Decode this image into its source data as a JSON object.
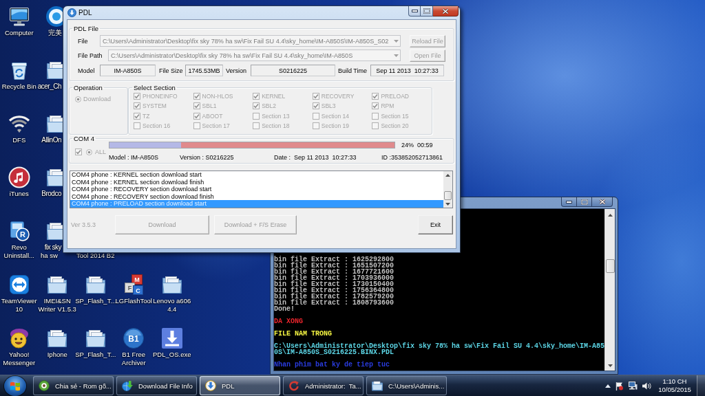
{
  "desktop": {
    "icon_columns": [
      {
        "icons": [
          {
            "kind": "computer",
            "label_lines": [
              "Computer"
            ],
            "cut": false
          },
          {
            "kind": "recycle-bin",
            "label_lines": [
              "Recycle Bin"
            ],
            "cut": false
          },
          {
            "kind": "wifi",
            "label_lines": [
              "DFS"
            ],
            "cut": false
          },
          {
            "kind": "music",
            "label_lines": [
              "iTunes"
            ],
            "cut": false
          },
          {
            "kind": "badge",
            "logo_text": "R",
            "label_lines": [
              "Revo",
              "Uninstall..."
            ],
            "cut": false
          },
          {
            "kind": "remote",
            "label_lines": [
              "TeamViewer",
              "10"
            ],
            "cut": false
          },
          {
            "kind": "smiley",
            "label_lines": [
              "Yahoo!",
              "Messenger"
            ],
            "cut": false
          }
        ]
      },
      {
        "icons": [
          {
            "kind": "ring",
            "label_lines": [
              "完美"
            ],
            "cut": true
          },
          {
            "kind": "folder",
            "label_lines": [
              "acer_Ch"
            ],
            "cut": true
          },
          {
            "kind": "folder",
            "label_lines": [
              "AllinOn"
            ],
            "cut": true
          },
          {
            "kind": "folder",
            "label_lines": [
              "Brodco"
            ],
            "cut": true
          },
          {
            "kind": "folder",
            "label_lines": [
              "fix sky",
              "ha sw"
            ],
            "cut": true
          },
          {
            "kind": "folder",
            "label_lines": [
              "IMEI&SN",
              "Writer V1.5.3"
            ],
            "cut": false
          },
          {
            "kind": "folder",
            "label_lines": [
              "Iphone"
            ],
            "cut": false
          }
        ]
      },
      {
        "icons": [
          {
            "label_lines": [
              "Tool 2014 B2"
            ],
            "cut": false
          },
          {
            "kind": "folder",
            "label_lines": [
              "SP_Flash_T..."
            ],
            "cut": false
          },
          {
            "kind": "folder",
            "label_lines": [
              "SP_Flash_T..."
            ],
            "cut": false
          }
        ]
      },
      {
        "icons": [
          {
            "kind": "cubes",
            "logo_letters": [
              "M",
              "F",
              "C"
            ],
            "label_lines": [
              "LGFlashTool"
            ],
            "cut": false
          },
          {
            "kind": "disc",
            "logo_text": "B1",
            "label_lines": [
              "B1 Free",
              "Archiver"
            ],
            "cut": false
          }
        ]
      },
      {
        "icons": [
          {
            "kind": "folder",
            "label_lines": [
              "Lenovo a606",
              "4.4"
            ],
            "cut": false
          },
          {
            "kind": "download",
            "label_lines": [
              "PDL_OS.exe"
            ],
            "cut": false
          }
        ]
      }
    ]
  },
  "console_window": {
    "blocks": [
      {
        "color": "#c0c0c0",
        "lines": [
          "bin file Extract : 1625292800",
          "bin file Extract : 1651507200",
          "bin file Extract : 1677721600",
          "bin file Extract : 1703936000",
          "bin file Extract : 1730150400",
          "bin file Extract : 1756364800",
          "bin file Extract : 1782579200",
          "bin file Extract : 1808793600",
          "Done!"
        ]
      },
      {
        "color": "#e8242c",
        "lines": [
          "DA XONG"
        ]
      },
      {
        "color": "#f4f442",
        "lines": [
          "FILE NAM TRONG"
        ]
      },
      {
        "color": "#5cd6e6",
        "lines": [
          "C:\\Users\\Administrator\\Desktop\\fix sky 78% ha sw\\Fix Fail SU 4.4\\sky_home\\IM-A85",
          "0S\\IM-A850S_S0216225.BINX.PDL"
        ]
      },
      {
        "color": "#2a3ce0",
        "lines": [
          "Nhan phim bat ky de tiep tuc"
        ]
      }
    ]
  },
  "pdl_window": {
    "title": "PDL",
    "pdl_file": {
      "legend": "PDL File",
      "combos": [
        {
          "label": "File",
          "value": "C:\\Users\\Administrator\\Desktop\\fix sky 78% ha sw\\Fix Fail SU 4.4\\sky_home\\IM-A850S\\IM-A850S_S02",
          "button": "Reload File",
          "disabled": true
        },
        {
          "label": "File Path",
          "value": "C:\\Users\\Administrator\\Desktop\\fix sky 78% ha sw\\Fix Fail SU 4.4\\sky_home\\IM-A850S",
          "button": "Open File",
          "disabled": true
        }
      ],
      "info": [
        {
          "label": "Model",
          "value": "IM-A850S"
        },
        {
          "label": "File Size",
          "value": "1745.53MB"
        },
        {
          "label": "Version",
          "value": "S0216225"
        },
        {
          "label": "Build Time",
          "value": "Sep 11 2013  10:27:33"
        }
      ]
    },
    "operation": {
      "legend": "Operation",
      "disabled": true,
      "options": [
        {
          "label": "Download",
          "selected": true
        }
      ]
    },
    "select_section": {
      "legend": "Select Section",
      "disabled": true,
      "sections": [
        {
          "label": "PHONEINFO",
          "checked": true
        },
        {
          "label": "NON-HLOS",
          "checked": true
        },
        {
          "label": "KERNEL",
          "checked": true
        },
        {
          "label": "RECOVERY",
          "checked": true
        },
        {
          "label": "PRELOAD",
          "checked": true
        },
        {
          "label": "SYSTEM",
          "checked": true
        },
        {
          "label": "SBL1",
          "checked": true
        },
        {
          "label": "SBL2",
          "checked": true
        },
        {
          "label": "SBL3",
          "checked": true
        },
        {
          "label": "RPM",
          "checked": true
        },
        {
          "label": "TZ",
          "checked": true
        },
        {
          "label": "ABOOT",
          "checked": true
        },
        {
          "label": "Section 13",
          "checked": false
        },
        {
          "label": "Section 14",
          "checked": false
        },
        {
          "label": "Section 15",
          "checked": false
        },
        {
          "label": "Section 16",
          "checked": false
        },
        {
          "label": "Section 17",
          "checked": false
        },
        {
          "label": "Section 18",
          "checked": false
        },
        {
          "label": "Section 19",
          "checked": false
        },
        {
          "label": "Section 20",
          "checked": false
        }
      ]
    },
    "com_port": {
      "legend": "COM 4",
      "checked": true,
      "disabled": true,
      "all": {
        "label": "ALL",
        "selected": true
      },
      "progress": {
        "level": 0.25
      },
      "reading": "24%  00:59",
      "details": [
        "Model : IM-A850S",
        "Version : S0216225",
        "Date :  Sep 11 2013  10:27:33",
        "ID :353852052713861"
      ]
    },
    "log": {
      "lines": [
        {
          "text": "COM4 phone : KERNEL section download start",
          "selected": false
        },
        {
          "text": "COM4 phone : KERNEL section download finish",
          "selected": false
        },
        {
          "text": "COM4 phone : RECOVERY section download start",
          "selected": false
        },
        {
          "text": "COM4 phone : RECOVERY section download finish",
          "selected": false
        },
        {
          "text": "COM4 phone : PRELOAD section download start",
          "selected": true
        }
      ]
    },
    "version": "Ver 3.5.3",
    "buttons": [
      {
        "label": "Download",
        "disabled": true
      },
      {
        "label": "Download + F/S Erase",
        "disabled": true
      },
      {
        "label": "Exit",
        "disabled": false
      }
    ]
  },
  "taskbar": {
    "items": [
      {
        "kind": "browser",
        "label": "Chia sẻ - Rom gố...",
        "selected": false
      },
      {
        "kind": "download-manager",
        "label": "Download File Info",
        "selected": false
      },
      {
        "kind": "installer",
        "label": "PDL",
        "selected": true
      },
      {
        "kind": "console",
        "label": "Administrator:  Ta...",
        "selected": false
      },
      {
        "kind": "folder",
        "label": "C:\\Users\\Adminis...",
        "selected": false
      }
    ],
    "clock": {
      "time": "1:10 CH",
      "date": "10/05/2015"
    }
  }
}
